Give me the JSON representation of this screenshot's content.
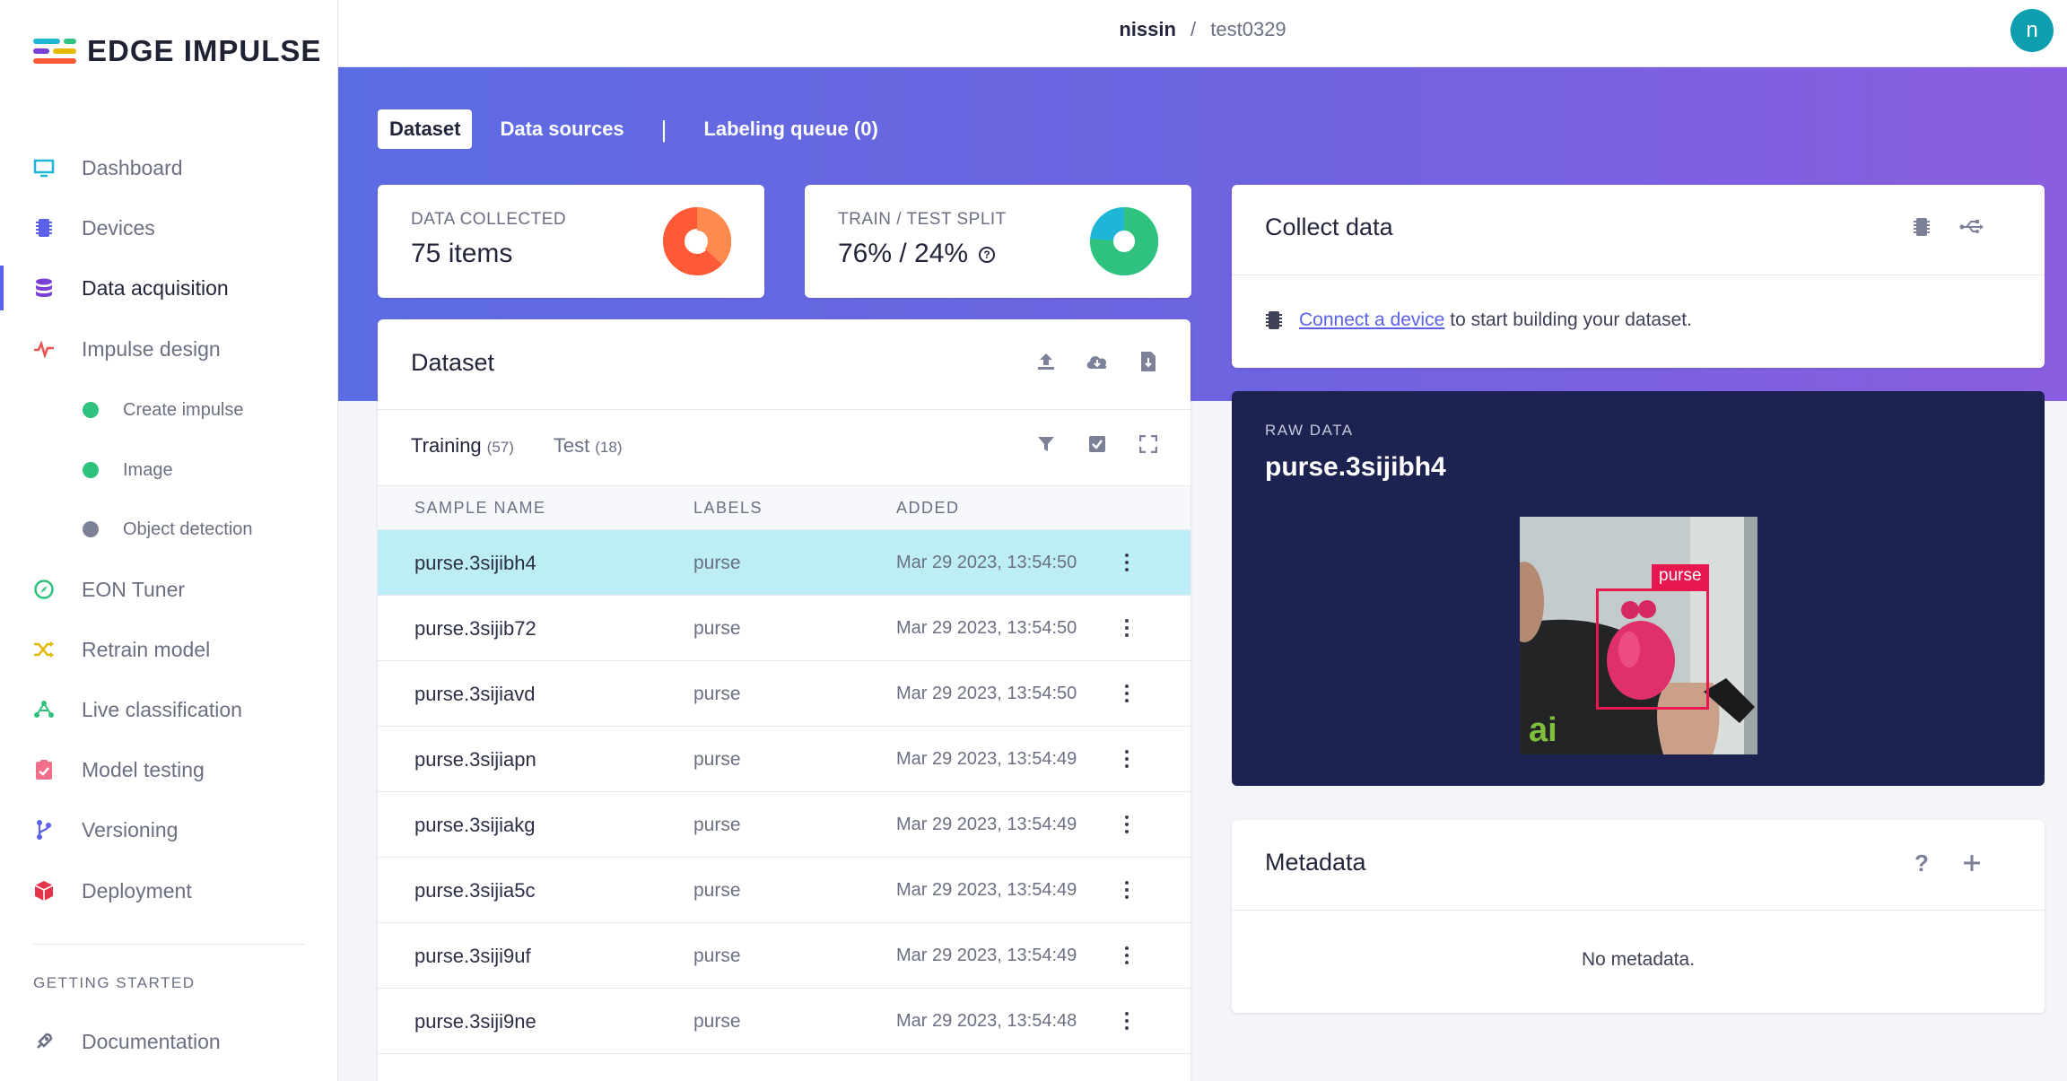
{
  "brand": {
    "name": "EDGE IMPULSE"
  },
  "topbar": {
    "user": "nissin",
    "separator": "/",
    "project": "test0329",
    "avatar_initial": "n",
    "avatar_color": "#0e9eb0"
  },
  "sidebar": {
    "items": [
      {
        "label": "Dashboard",
        "icon": "monitor-icon",
        "color": "#1fb5d6"
      },
      {
        "label": "Devices",
        "icon": "chip-icon",
        "color": "#5b61e8"
      },
      {
        "label": "Data acquisition",
        "icon": "database-icon",
        "color": "#7a3fd6",
        "active": true
      },
      {
        "label": "Impulse design",
        "icon": "pulse-icon",
        "color": "#e9544f"
      },
      {
        "label": "EON Tuner",
        "icon": "compass-icon",
        "color": "#2ec27e"
      },
      {
        "label": "Retrain model",
        "icon": "shuffle-icon",
        "color": "#e6b800"
      },
      {
        "label": "Live classification",
        "icon": "network-icon",
        "color": "#2ec27e"
      },
      {
        "label": "Model testing",
        "icon": "clipboard-check-icon",
        "color": "#f0708a"
      },
      {
        "label": "Versioning",
        "icon": "branch-icon",
        "color": "#5b61e8"
      },
      {
        "label": "Deployment",
        "icon": "cube-icon",
        "color": "#e5334b"
      }
    ],
    "sub_items": [
      {
        "label": "Create impulse",
        "status_color": "#2ec27e"
      },
      {
        "label": "Image",
        "status_color": "#2ec27e"
      },
      {
        "label": "Object detection",
        "status_color": "#7c8198"
      }
    ],
    "section_heading": "GETTING STARTED",
    "documentation": {
      "label": "Documentation",
      "icon": "rocket-icon"
    }
  },
  "tabs": {
    "dataset": "Dataset",
    "data_sources": "Data sources",
    "separator": "|",
    "labeling_queue": "Labeling queue (0)"
  },
  "stats": {
    "collected": {
      "label": "DATA COLLECTED",
      "value": "75 items",
      "chart_colors": [
        "#ff5a36",
        "#ff8a50"
      ]
    },
    "split": {
      "label": "TRAIN / TEST SPLIT",
      "value": "76% / 24%",
      "train_fraction": 0.76,
      "chart_colors": [
        "#2ec27e",
        "#1fb5d6"
      ]
    }
  },
  "dataset": {
    "title": "Dataset",
    "training_tab": "Training",
    "training_count": "(57)",
    "test_tab": "Test",
    "test_count": "(18)",
    "columns": {
      "name": "SAMPLE NAME",
      "labels": "LABELS",
      "added": "ADDED"
    },
    "rows": [
      {
        "name": "purse.3sijibh4",
        "label": "purse",
        "added": "Mar 29 2023, 13:54:50",
        "selected": true
      },
      {
        "name": "purse.3sijib72",
        "label": "purse",
        "added": "Mar 29 2023, 13:54:50"
      },
      {
        "name": "purse.3sijiavd",
        "label": "purse",
        "added": "Mar 29 2023, 13:54:50"
      },
      {
        "name": "purse.3sijiapn",
        "label": "purse",
        "added": "Mar 29 2023, 13:54:49"
      },
      {
        "name": "purse.3sijiakg",
        "label": "purse",
        "added": "Mar 29 2023, 13:54:49"
      },
      {
        "name": "purse.3sijia5c",
        "label": "purse",
        "added": "Mar 29 2023, 13:54:49"
      },
      {
        "name": "purse.3siji9uf",
        "label": "purse",
        "added": "Mar 29 2023, 13:54:49"
      },
      {
        "name": "purse.3siji9ne",
        "label": "purse",
        "added": "Mar 29 2023, 13:54:48"
      }
    ]
  },
  "collect": {
    "title": "Collect data",
    "link_text": "Connect a device",
    "rest_text": "to start building your dataset."
  },
  "raw": {
    "label": "RAW DATA",
    "name": "purse.3sijibh4",
    "bbox_label": "purse",
    "bbox_color": "#e8174f"
  },
  "metadata": {
    "title": "Metadata",
    "empty": "No metadata."
  }
}
